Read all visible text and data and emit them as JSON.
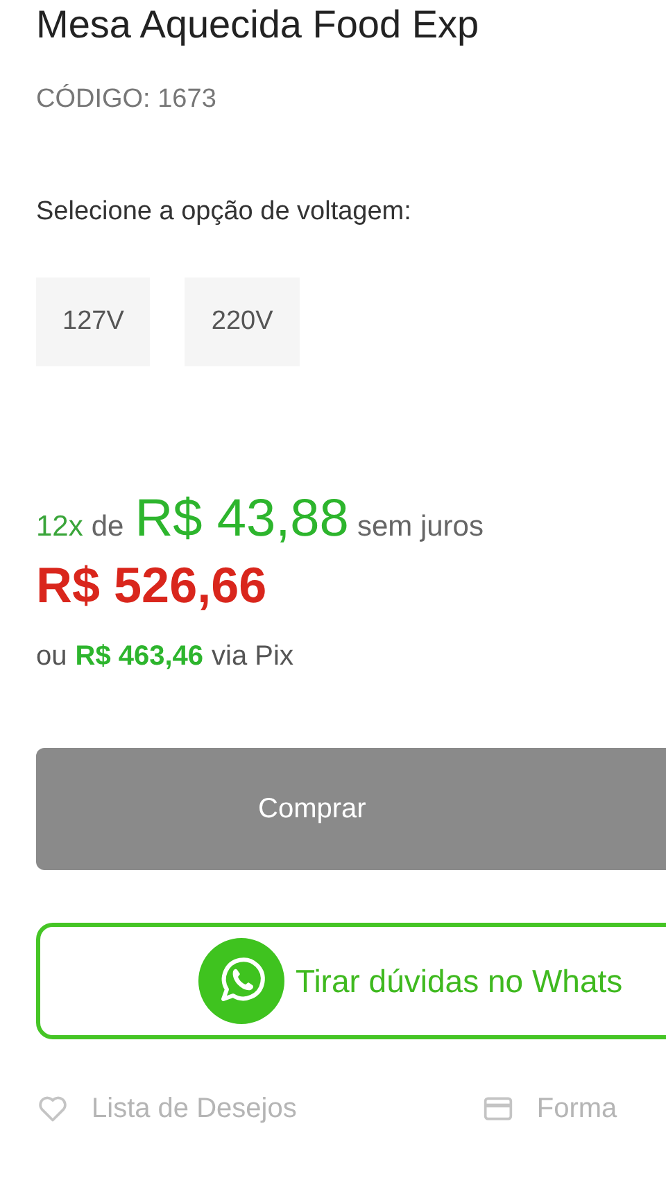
{
  "product": {
    "title": "Mesa Aquecida Food Exp",
    "code": "CÓDIGO: 1673"
  },
  "voltage": {
    "label": "Selecione a opção de voltagem:",
    "options": [
      {
        "label": "127V",
        "selected": false
      },
      {
        "label": "220V",
        "selected": false
      }
    ]
  },
  "installments": {
    "count": "12x",
    "joiner": "de",
    "amount": "R$ 43,88",
    "suffix": "sem juros"
  },
  "price": "R$ 526,66",
  "pix": {
    "prefix": "ou",
    "amount": "R$ 463,46",
    "suffix": "via Pix"
  },
  "buy_button": "Comprar",
  "whatsapp_button": "Tirar dúvidas no Whats",
  "links": [
    {
      "kind": "wishlist",
      "label": "Lista de Desejos"
    },
    {
      "kind": "payment",
      "label": "Forma"
    }
  ]
}
